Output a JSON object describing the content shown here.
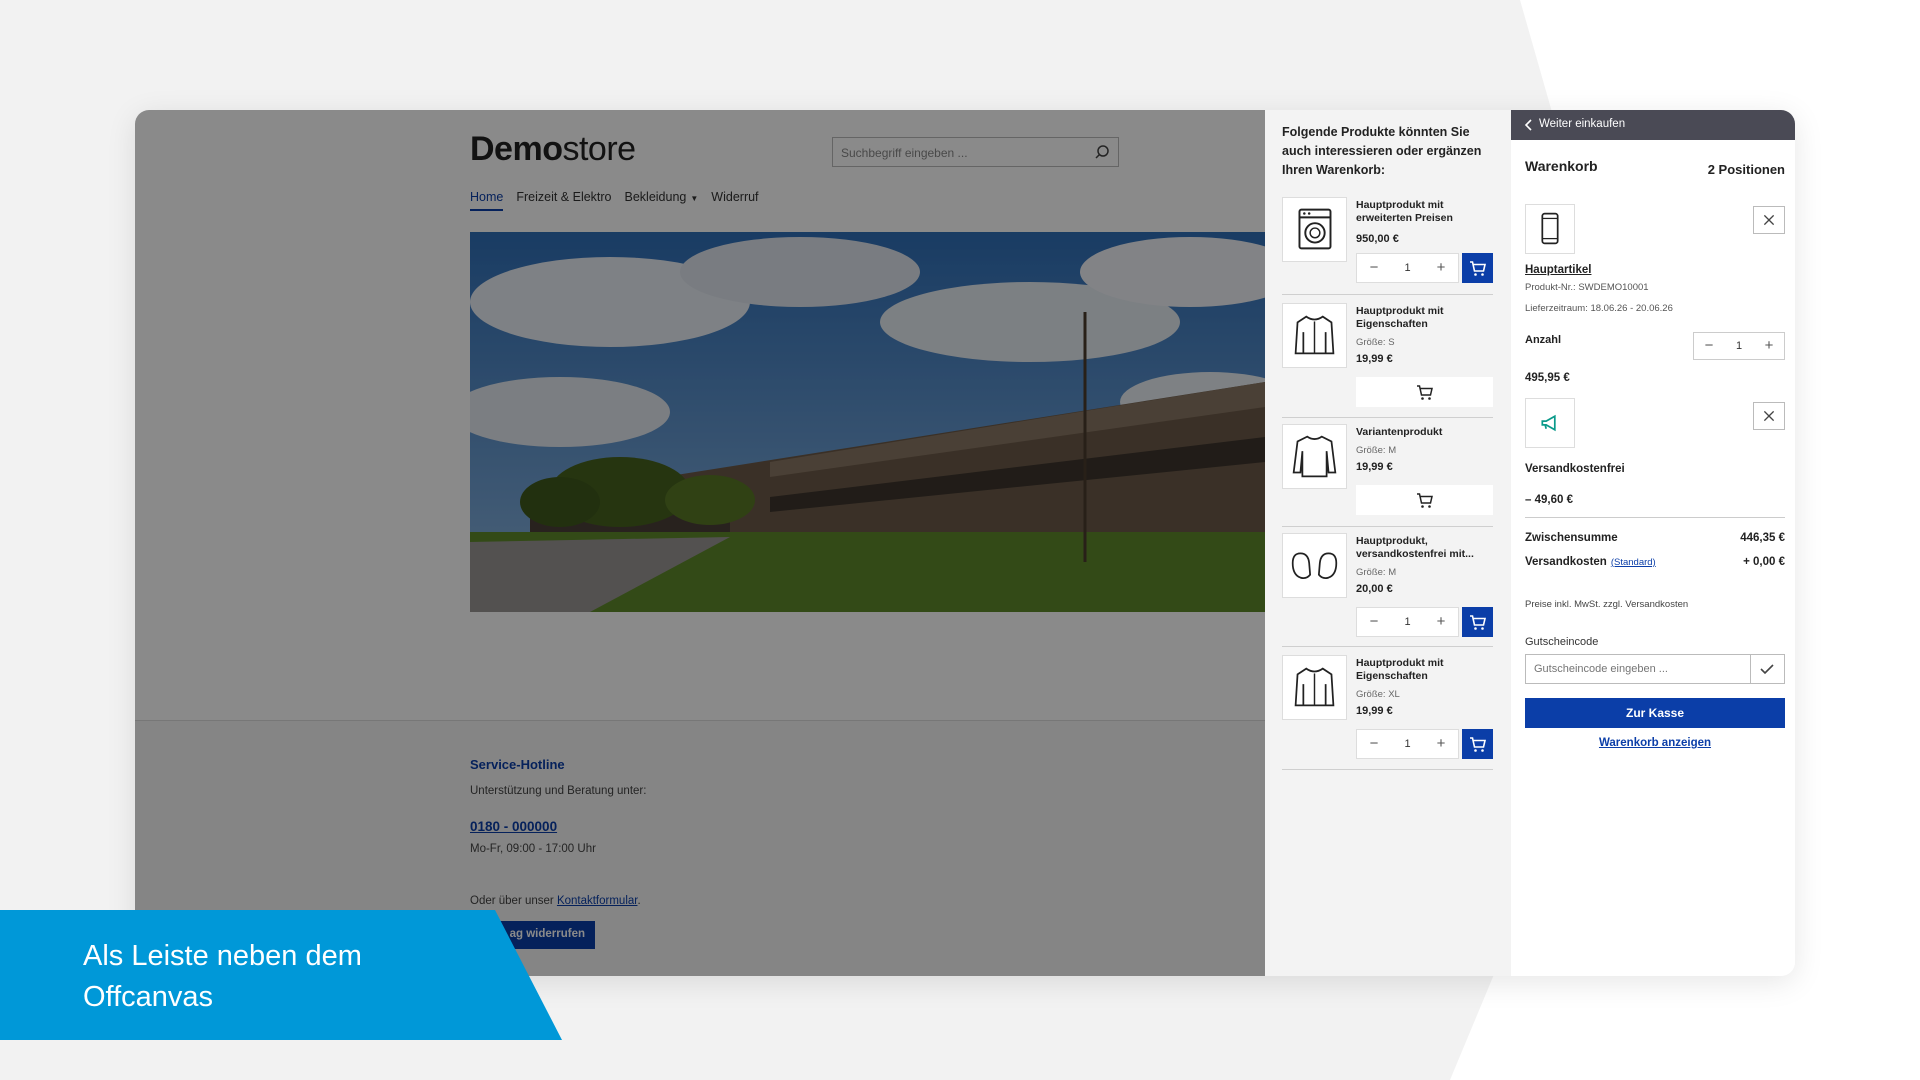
{
  "store": {
    "logo_bold": "Demo",
    "logo_light": "store",
    "search_placeholder": "Suchbegriff eingeben ...",
    "nav": [
      "Home",
      "Freizeit & Elektro",
      "Bekleidung",
      "Widerruf"
    ],
    "footer": {
      "title": "Service-Hotline",
      "support": "Unterstützung und Beratung unter:",
      "phone": "0180 - 000000",
      "hours": "Mo-Fr, 09:00 - 17:00 Uhr",
      "contact_prefix": "Oder über unser ",
      "contact_link": "Kontaktformular",
      "contact_suffix": ".",
      "revoke_button": "ag widerrufen"
    }
  },
  "crosssell": {
    "title": "Folgende Produkte könnten Sie auch interessieren oder ergänzen Ihren Warenkorb:",
    "items": [
      {
        "name": "Hauptprodukt mit erweiterten Preisen",
        "variant": "",
        "price": "950,00 €",
        "qty": "1"
      },
      {
        "name": "Hauptprodukt mit Eigenschaften",
        "variant": "Größe: S",
        "price": "19,99 €",
        "qty": ""
      },
      {
        "name": "Variantenprodukt",
        "variant": "Größe: M",
        "price": "19,99 €",
        "qty": ""
      },
      {
        "name": "Hauptprodukt, versandkostenfrei mit...",
        "variant": "Größe: M",
        "price": "20,00 €",
        "qty": "1"
      },
      {
        "name": "Hauptprodukt mit Eigenschaften",
        "variant": "Größe: XL",
        "price": "19,99 €",
        "qty": "1"
      }
    ]
  },
  "cart": {
    "back": "Weiter einkaufen",
    "title": "Warenkorb",
    "count": "2 Positionen",
    "item": {
      "name": "Hauptartikel",
      "sku": "Produkt-Nr.: SWDEMO10001",
      "delivery": "Lieferzeitraum: 18.06.26 - 20.06.26",
      "qty_label": "Anzahl",
      "qty": "1",
      "price": "495,95 €"
    },
    "promo": {
      "name": "Versandkostenfrei",
      "price": "– 49,60 €"
    },
    "subtotal_label": "Zwischensumme",
    "subtotal": "446,35 €",
    "shipping_label": "Versandkosten",
    "shipping_method": "(Standard)",
    "shipping": "+ 0,00 €",
    "tax_note": "Preise inkl. MwSt. zzgl. Versandkosten",
    "voucher_label": "Gutscheincode",
    "voucher_placeholder": "Gutscheincode eingeben ...",
    "checkout": "Zur Kasse",
    "view_cart": "Warenkorb anzeigen"
  },
  "caption": "Als Leiste neben dem Offcanvas",
  "colors": {
    "brand_blue": "#0b3ea8",
    "caption_blue": "#0098d8",
    "topbar": "#4a4a55"
  }
}
